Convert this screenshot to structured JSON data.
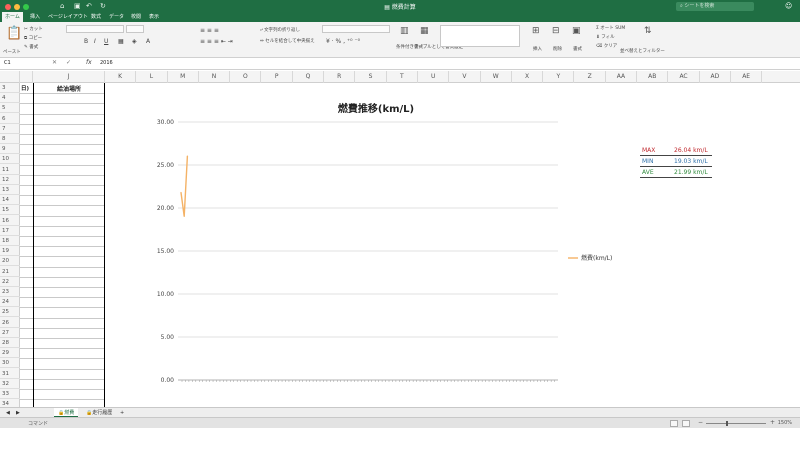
{
  "window": {
    "title": "燃費計算",
    "search_placeholder": "シートを検索"
  },
  "ribbon_tabs": [
    "ホーム",
    "挿入",
    "ページレイアウト",
    "数式",
    "データ",
    "校閲",
    "表示"
  ],
  "ribbon": {
    "paste": "ペースト",
    "cut": "カット",
    "copy": "コピー",
    "format_painter": "書式",
    "wrap_text": "文字列の折り返し",
    "merge_center": "セルを結合して中央揃え",
    "conditional_format": "条件付き書式",
    "table_format": "テーブルとして書式設定",
    "insert": "挿入",
    "delete": "削除",
    "format": "書式",
    "autosum": "オート SUM",
    "fill": "フィル",
    "clear": "クリア",
    "sort_filter": "並べ替えとフィルター"
  },
  "formula_bar": {
    "name_box": "C1",
    "fx": "fx",
    "value": "2016"
  },
  "columns": [
    "J",
    "K",
    "L",
    "M",
    "N",
    "O",
    "P",
    "Q",
    "R",
    "S",
    "T",
    "U",
    "V",
    "W",
    "X",
    "Y",
    "Z",
    "AA",
    "AB",
    "AC",
    "AD",
    "AE"
  ],
  "rows": [
    "3",
    "4",
    "5",
    "6",
    "7",
    "8",
    "9",
    "10",
    "11",
    "12",
    "13",
    "14",
    "15",
    "16",
    "17",
    "18",
    "19",
    "20",
    "21",
    "22",
    "23",
    "24",
    "25",
    "26",
    "27",
    "28",
    "29",
    "30",
    "31",
    "32",
    "33",
    "34"
  ],
  "column_i_partial": "日)",
  "header_cell": "給油場所",
  "chart_data": {
    "type": "line",
    "title": "燃費推移(km/L)",
    "ylim": [
      0,
      30
    ],
    "y_ticks": [
      "0.00",
      "5.00",
      "10.00",
      "15.00",
      "20.00",
      "25.00",
      "30.00"
    ],
    "series": [
      {
        "name": "燃費(km/L)",
        "color": "#f4b266",
        "values": [
          21.8,
          19.03,
          26.04
        ]
      }
    ],
    "legend_position": "right",
    "grid": true
  },
  "stats": [
    {
      "label": "MAX",
      "value": "26.04 km/L",
      "color": "#c0282d"
    },
    {
      "label": "MIN",
      "value": "19.03 km/L",
      "color": "#2e6fa8"
    },
    {
      "label": "AVE",
      "value": "21.99 km/L",
      "color": "#2f8a3c"
    }
  ],
  "sheet_tabs": [
    {
      "label": "燃費",
      "active": true
    },
    {
      "label": "走行履歴",
      "active": false
    }
  ],
  "status": {
    "mode": "コマンド",
    "zoom": "150%"
  },
  "colors": {
    "excel_green": "#1f6e43"
  }
}
